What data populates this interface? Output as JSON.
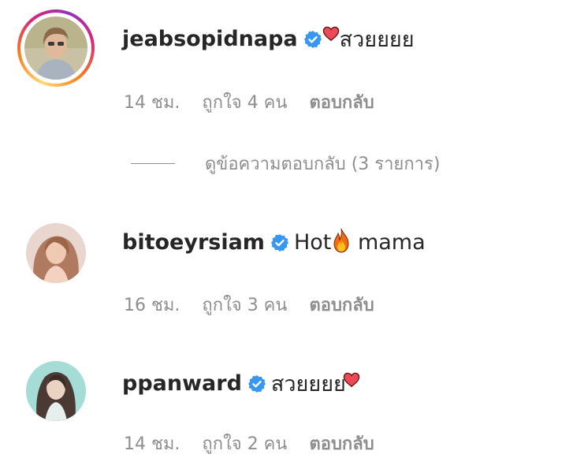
{
  "comments": [
    {
      "username": "jeabsopidnapa",
      "verified": true,
      "text": "สวยยยย",
      "emoji": "red-heart",
      "time": "14 ชม.",
      "likes": "ถูกใจ 4 คน",
      "reply_label": "ตอบกลับ",
      "has_story": true,
      "view_replies": "ดูข้อความตอบกลับ (3 รายการ)"
    },
    {
      "username": "bitoeyrsiam",
      "verified": true,
      "text_before": "Hot",
      "emoji": "fire",
      "text_after": " mama",
      "time": "16 ชม.",
      "likes": "ถูกใจ 3 คน",
      "reply_label": "ตอบกลับ"
    },
    {
      "username": "ppanward",
      "verified": true,
      "text": "สวยยยย",
      "emoji": "red-heart",
      "time": "14 ชม.",
      "likes": "ถูกใจ 2 คน",
      "reply_label": "ตอบกลับ"
    }
  ],
  "colors": {
    "verified_blue": "#3897f0",
    "text_primary": "#262626",
    "text_secondary": "#8e8e8e",
    "heart_red": "#ed4956"
  }
}
